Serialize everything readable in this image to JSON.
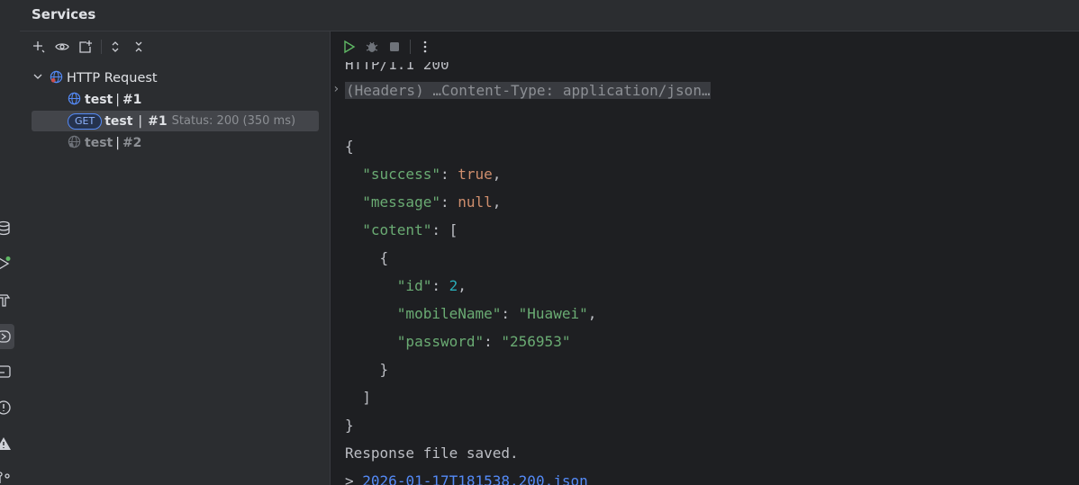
{
  "header": {
    "title": "Services"
  },
  "tree": {
    "root_label": "HTTP Request",
    "items": [
      {
        "name": "test",
        "sep": "|",
        "id": "#1"
      },
      {
        "badge": "GET",
        "name": "test",
        "sep": "|",
        "id": "#1",
        "status": "Status: 200 (350 ms)"
      },
      {
        "name": "test",
        "sep": "|",
        "id": "#2"
      }
    ]
  },
  "console": {
    "status_line": "HTTP/1.1 200",
    "headers_summary": "(Headers) …Content-Type: application/json…",
    "json": {
      "open": "{",
      "success_key": "\"success\"",
      "success_val": "true",
      "message_key": "\"message\"",
      "message_val": "null",
      "content_key": "\"cotent\"",
      "arr_open": "[",
      "obj_open": "{",
      "id_key": "\"id\"",
      "id_val": "2",
      "mobile_key": "\"mobileName\"",
      "mobile_val": "\"Huawei\"",
      "password_key": "\"password\"",
      "password_val": "\"256953\"",
      "obj_close": "}",
      "arr_close": "]",
      "close": "}"
    },
    "saved_text": "Response file saved.",
    "file_prefix": ">",
    "file_link": "2026-01-17T181538.200.json"
  },
  "icons": {
    "toolbar": [
      "add-icon",
      "eye-icon",
      "new-tab-icon",
      "expand-all-icon",
      "collapse-all-icon"
    ],
    "run": [
      "run-icon",
      "debug-icon",
      "stop-icon",
      "more-icon"
    ]
  },
  "colors": {
    "accent": "#548af7",
    "run": "#5fb865",
    "string": "#6aab73",
    "keyword": "#cf8e6d",
    "number": "#2aacb8"
  }
}
